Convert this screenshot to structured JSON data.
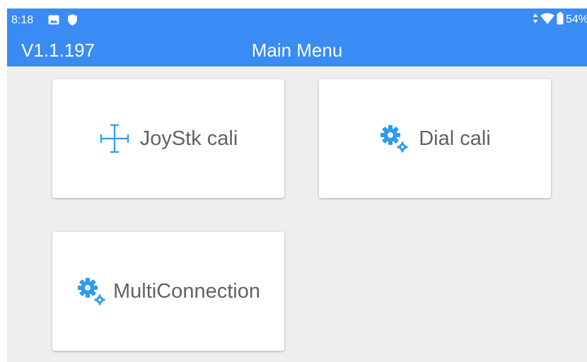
{
  "status_bar": {
    "time": "8:18",
    "battery": "54%",
    "icons": [
      "image-icon",
      "shield-icon",
      "data-arrows-icon",
      "wifi-icon",
      "battery-icon"
    ]
  },
  "header": {
    "version": "V1.1.197",
    "title": "Main Menu"
  },
  "menu": {
    "items": [
      {
        "label": "JoyStk cali",
        "icon": "crosshair-icon"
      },
      {
        "label": "Dial cali",
        "icon": "gears-icon"
      },
      {
        "label": "MultiConnection",
        "icon": "gears-icon"
      }
    ]
  },
  "colors": {
    "accent": "#3a8bf4",
    "icon_blue": "#2b9cf0",
    "background": "#eeeeee",
    "card": "#ffffff",
    "card_text": "#5f6368"
  }
}
